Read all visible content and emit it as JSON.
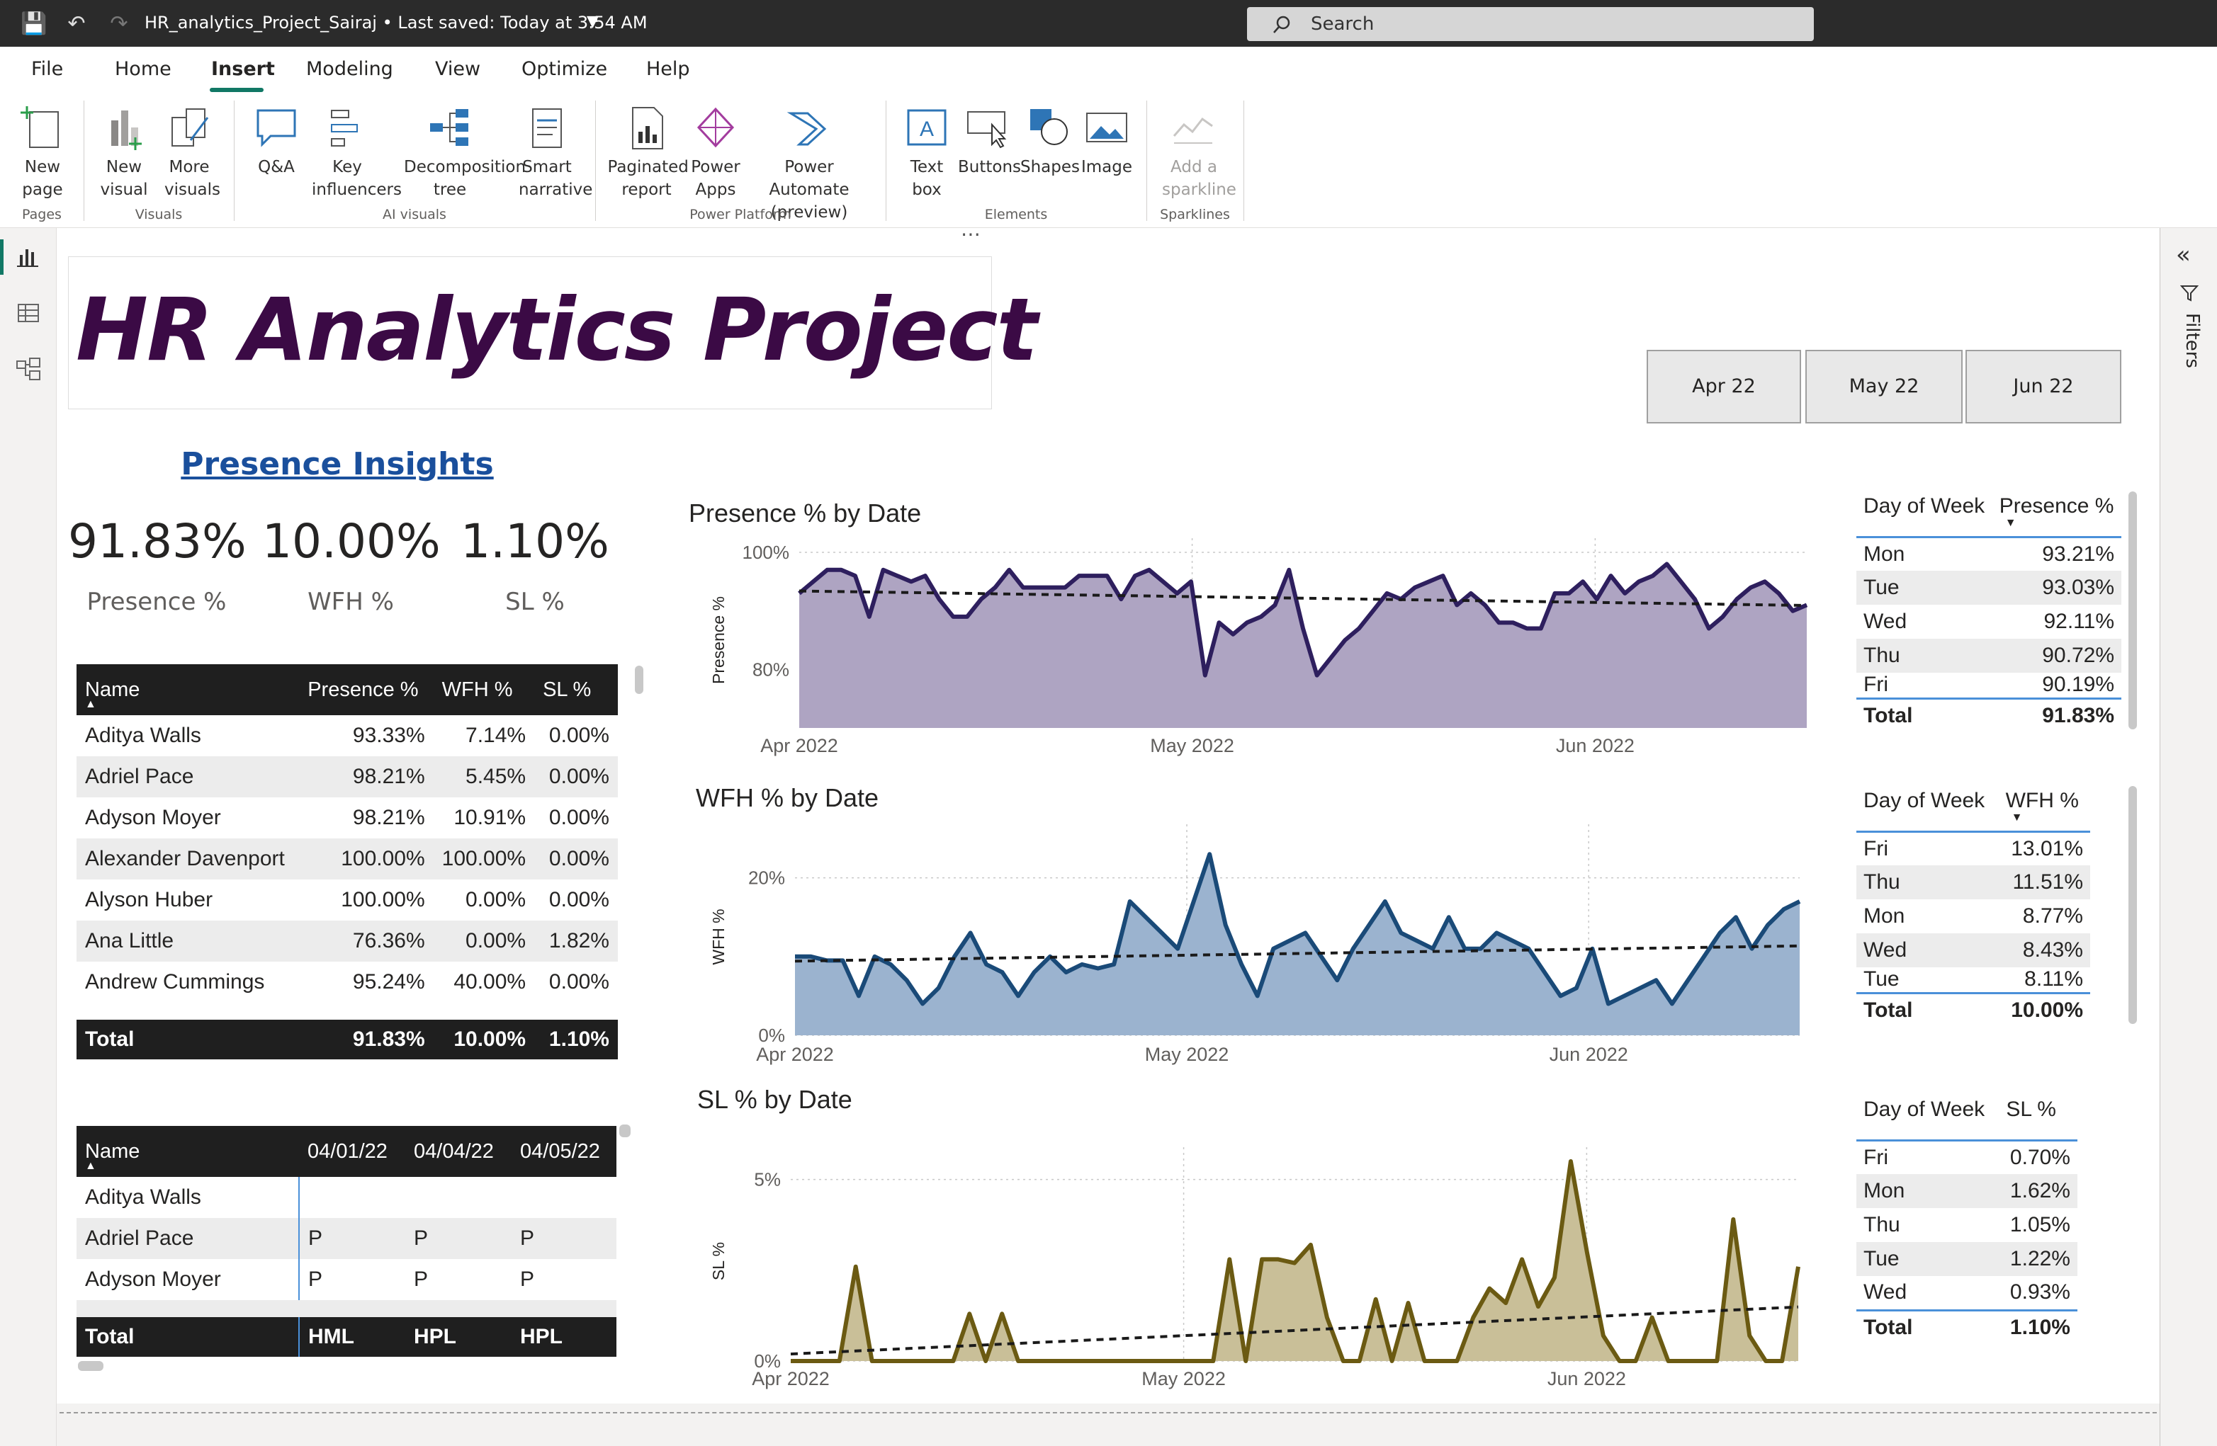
{
  "app": {
    "doc_title": "HR_analytics_Project_Sairaj • Last saved: Today at 3:54 AM",
    "search_placeholder": "Search"
  },
  "menu": [
    "File",
    "Home",
    "Insert",
    "Modeling",
    "View",
    "Optimize",
    "Help"
  ],
  "ribbon": {
    "buttons": {
      "new_page": "New page",
      "new_visual": "New visual",
      "more_visuals": "More visuals",
      "qa": "Q&A",
      "key_influencers": "Key influencers",
      "decomposition_tree": "Decomposition tree",
      "smart_narrative": "Smart narrative",
      "paginated_report": "Paginated report",
      "power_apps": "Power Apps",
      "power_automate": "Power Automate (preview)",
      "text_box": "Text box",
      "buttons": "Buttons",
      "shapes": "Shapes",
      "image": "Image",
      "add_sparkline": "Add a sparkline"
    },
    "groups": {
      "pages": "Pages",
      "visuals": "Visuals",
      "ai_visuals": "AI visuals",
      "power_platform": "Power Platform",
      "elements": "Elements",
      "sparklines": "Sparklines"
    }
  },
  "right_pane": {
    "filters": "Filters"
  },
  "report": {
    "title": "HR Analytics Project",
    "slicer": [
      "Apr 22",
      "May 22",
      "Jun 22"
    ],
    "insights_title": "Presence Insights",
    "kpis": [
      {
        "value": "91.83%",
        "label": "Presence %"
      },
      {
        "value": "10.00%",
        "label": "WFH %"
      },
      {
        "value": "1.10%",
        "label": "SL %"
      }
    ],
    "employee_table": {
      "headers": [
        "Name",
        "Presence %",
        "WFH %",
        "SL %"
      ],
      "rows": [
        [
          "Aditya Walls",
          "93.33%",
          "7.14%",
          "0.00%"
        ],
        [
          "Adriel Pace",
          "98.21%",
          "5.45%",
          "0.00%"
        ],
        [
          "Adyson Moyer",
          "98.21%",
          "10.91%",
          "0.00%"
        ],
        [
          "Alexander Davenport",
          "100.00%",
          "100.00%",
          "0.00%"
        ],
        [
          "Alyson Huber",
          "100.00%",
          "0.00%",
          "0.00%"
        ],
        [
          "Ana Little",
          "76.36%",
          "0.00%",
          "1.82%"
        ],
        [
          "Andrew Cummings",
          "95.24%",
          "40.00%",
          "0.00%"
        ]
      ],
      "total": [
        "Total",
        "91.83%",
        "10.00%",
        "1.10%"
      ]
    },
    "matrix": {
      "headers": [
        "Name",
        "04/01/22",
        "04/04/22",
        "04/05/22"
      ],
      "rows": [
        [
          "Aditya Walls",
          "",
          "",
          ""
        ],
        [
          "Adriel Pace",
          "P",
          "P",
          "P"
        ],
        [
          "Adyson Moyer",
          "P",
          "P",
          "P"
        ]
      ],
      "total": [
        "Total",
        "HML",
        "HPL",
        "HPL"
      ]
    },
    "dow_presence": {
      "headers": [
        "Day of Week",
        "Presence %"
      ],
      "rows": [
        [
          "Mon",
          "93.21%"
        ],
        [
          "Tue",
          "93.03%"
        ],
        [
          "Wed",
          "92.11%"
        ],
        [
          "Thu",
          "90.72%"
        ],
        [
          "Fri",
          "90.19%"
        ]
      ],
      "total": [
        "Total",
        "91.83%"
      ]
    },
    "dow_wfh": {
      "headers": [
        "Day of Week",
        "WFH %"
      ],
      "rows": [
        [
          "Fri",
          "13.01%"
        ],
        [
          "Thu",
          "11.51%"
        ],
        [
          "Mon",
          "8.77%"
        ],
        [
          "Wed",
          "8.43%"
        ],
        [
          "Tue",
          "8.11%"
        ]
      ],
      "total": [
        "Total",
        "10.00%"
      ]
    },
    "dow_sl": {
      "headers": [
        "Day of Week",
        "SL %"
      ],
      "rows": [
        [
          "Fri",
          "0.70%"
        ],
        [
          "Mon",
          "1.62%"
        ],
        [
          "Thu",
          "1.05%"
        ],
        [
          "Tue",
          "1.22%"
        ],
        [
          "Wed",
          "0.93%"
        ]
      ],
      "total": [
        "Total",
        "1.10%"
      ]
    }
  },
  "chart_data": [
    {
      "type": "area",
      "title": "Presence % by Date",
      "ylabel": "Presence %",
      "xlabel": "",
      "x_ticks": [
        "Apr 2022",
        "May 2022",
        "Jun 2022"
      ],
      "y_ticks": [
        "80%",
        "100%"
      ],
      "ylim": [
        70,
        100
      ],
      "color": "#2e1f5e",
      "fill": "#aea4c2",
      "trendline": true,
      "series": [
        {
          "values": [
            93,
            95,
            97,
            97,
            96,
            89,
            97,
            96,
            95,
            96,
            92,
            89,
            89,
            92,
            94,
            97,
            94,
            94,
            94,
            94,
            96,
            96,
            96,
            92,
            96,
            97,
            95,
            93,
            95,
            79,
            88,
            86,
            88,
            89,
            91,
            97,
            87,
            79,
            82,
            85,
            87,
            90,
            93,
            92,
            94,
            95,
            96,
            91,
            93,
            91,
            88,
            88,
            87,
            87,
            93,
            93,
            95,
            92,
            96,
            93,
            95,
            96,
            98,
            95,
            92,
            87,
            89,
            92,
            94,
            95,
            93,
            90,
            91
          ]
        }
      ]
    },
    {
      "type": "area",
      "title": "WFH % by Date",
      "ylabel": "WFH %",
      "xlabel": "",
      "x_ticks": [
        "Apr 2022",
        "May 2022",
        "Jun 2022"
      ],
      "y_ticks": [
        "0%",
        "20%"
      ],
      "ylim": [
        0,
        25
      ],
      "color": "#1a4a78",
      "fill": "#9bb3cf",
      "trendline": true,
      "series": [
        {
          "values": [
            10,
            10,
            9.5,
            9.5,
            5,
            10,
            9,
            7,
            4,
            6,
            10,
            13,
            9,
            8,
            5,
            8,
            10,
            8,
            9,
            8.5,
            9,
            17,
            15,
            13,
            11,
            17,
            23,
            14,
            9,
            5,
            11,
            12,
            13,
            10,
            7,
            11,
            14,
            17,
            13,
            12,
            11,
            15,
            11,
            11,
            13,
            12,
            11,
            8,
            5,
            6,
            11,
            4,
            5,
            6,
            7,
            4,
            7,
            10,
            13,
            15,
            11,
            14,
            16,
            17
          ]
        }
      ]
    },
    {
      "type": "area",
      "title": "SL % by Date",
      "ylabel": "SL %",
      "xlabel": "",
      "x_ticks": [
        "Apr 2022",
        "May 2022",
        "Jun 2022"
      ],
      "y_ticks": [
        "0%",
        "5%"
      ],
      "ylim": [
        0,
        5.5
      ],
      "color": "#6b5a12",
      "fill": "#c9bf98",
      "trendline": true,
      "series": [
        {
          "values": [
            0,
            0,
            0,
            0,
            2.6,
            0,
            0,
            0,
            0,
            0,
            0,
            1.3,
            0,
            1.3,
            0,
            0,
            0,
            0,
            0,
            0,
            0,
            0,
            0,
            0,
            0,
            0,
            0,
            2.8,
            0,
            2.8,
            2.8,
            2.7,
            3.2,
            1.2,
            0,
            0,
            1.7,
            0,
            1.6,
            0,
            0,
            0,
            1.2,
            2.0,
            1.6,
            2.8,
            1.5,
            2.3,
            5.5,
            3.0,
            0.7,
            0,
            0,
            1.2,
            0,
            0,
            0,
            0,
            3.9,
            0.7,
            0,
            0,
            2.6
          ]
        }
      ]
    }
  ]
}
